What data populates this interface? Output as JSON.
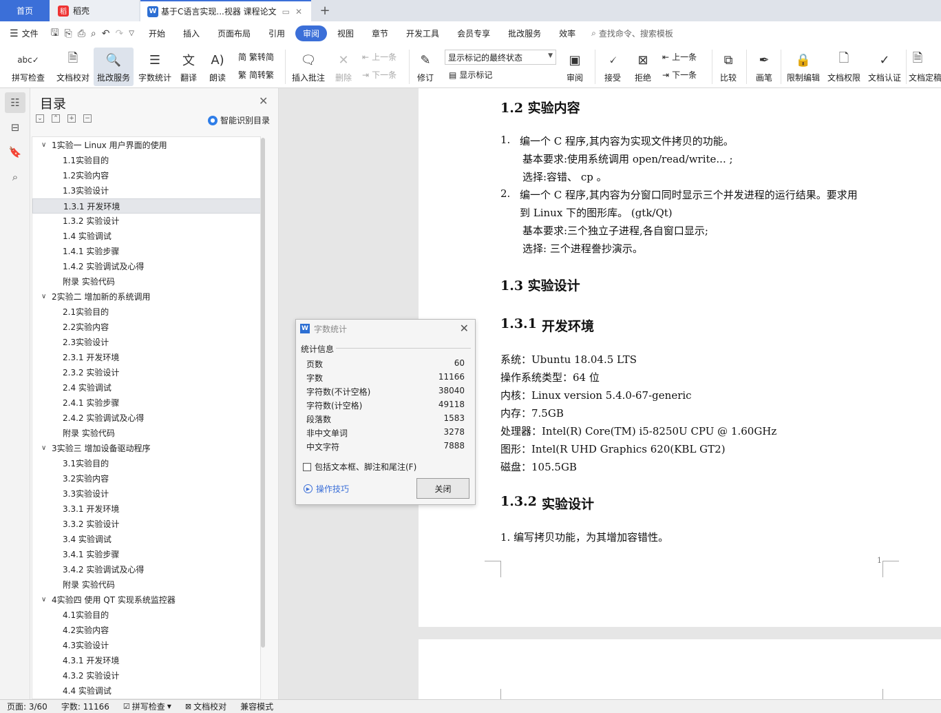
{
  "tabs": {
    "home": "首页",
    "daoke": "稻壳",
    "daoke_logo": "稻",
    "doc": "基于C语言实现...视器 课程论文",
    "doc_logo": "W",
    "plus": "+"
  },
  "menubar": {
    "file": "文件",
    "items": [
      "开始",
      "插入",
      "页面布局",
      "引用",
      "审阅",
      "视图",
      "章节",
      "开发工具",
      "会员专享",
      "批改服务",
      "效率"
    ],
    "active_item": "审阅",
    "search": "查找命令、搜索模板"
  },
  "ribbon": {
    "spell": "拼写检查",
    "proof": "文档校对",
    "correction": "批改服务",
    "wordcount": "字数统计",
    "translate": "翻译",
    "read": "朗读",
    "t2s": "繁转简",
    "s2t": "简转繁",
    "insert_comment": "插入批注",
    "delete": "删除",
    "prev_comment": "上一条",
    "next_comment": "下一条",
    "revise": "修订",
    "markup_state": "显示标记的最终状态",
    "show_markup": "显示标记",
    "review": "审阅",
    "accept": "接受",
    "reject": "拒绝",
    "prev_change": "上一条",
    "next_change": "下一条",
    "compare": "比较",
    "pen": "画笔",
    "restrict": "限制编辑",
    "permission": "文档权限",
    "certify": "文档认证",
    "finalize": "文档定稿"
  },
  "toc": {
    "title": "目录",
    "ai": "智能识别目录",
    "items": [
      {
        "label": "1实验一  Linux 用户界面的使用",
        "level": 1
      },
      {
        "label": "1.1实验目的",
        "level": 2
      },
      {
        "label": "1.2实验内容",
        "level": 2
      },
      {
        "label": "1.3实验设计",
        "level": 2
      },
      {
        "label": "1.3.1  开发环境",
        "level": 2,
        "selected": true
      },
      {
        "label": "1.3.2  实验设计",
        "level": 2
      },
      {
        "label": "1.4  实验调试",
        "level": 2
      },
      {
        "label": "1.4.1  实验步骤",
        "level": 2
      },
      {
        "label": "1.4.2  实验调试及心得",
        "level": 2
      },
      {
        "label": "附录  实验代码",
        "level": 2
      },
      {
        "label": "2实验二  增加新的系统调用",
        "level": 1
      },
      {
        "label": "2.1实验目的",
        "level": 2
      },
      {
        "label": "2.2实验内容",
        "level": 2
      },
      {
        "label": "2.3实验设计",
        "level": 2
      },
      {
        "label": "2.3.1  开发环境",
        "level": 2
      },
      {
        "label": "2.3.2  实验设计",
        "level": 2
      },
      {
        "label": "2.4  实验调试",
        "level": 2
      },
      {
        "label": "2.4.1  实验步骤",
        "level": 2
      },
      {
        "label": "2.4.2  实验调试及心得",
        "level": 2
      },
      {
        "label": "附录  实验代码",
        "level": 2
      },
      {
        "label": "3实验三  增加设备驱动程序",
        "level": 1
      },
      {
        "label": "3.1实验目的",
        "level": 2
      },
      {
        "label": "3.2实验内容",
        "level": 2
      },
      {
        "label": "3.3实验设计",
        "level": 2
      },
      {
        "label": "3.3.1  开发环境",
        "level": 2
      },
      {
        "label": "3.3.2  实验设计",
        "level": 2
      },
      {
        "label": "3.4  实验调试",
        "level": 2
      },
      {
        "label": "3.4.1  实验步骤",
        "level": 2
      },
      {
        "label": "3.4.2  实验调试及心得",
        "level": 2
      },
      {
        "label": "附录  实验代码",
        "level": 2
      },
      {
        "label": "4实验四  使用 QT 实现系统监控器",
        "level": 1
      },
      {
        "label": "4.1实验目的",
        "level": 2
      },
      {
        "label": "4.2实验内容",
        "level": 2
      },
      {
        "label": "4.3实验设计",
        "level": 2
      },
      {
        "label": "4.3.1  开发环境",
        "level": 2
      },
      {
        "label": "4.3.2  实验设计",
        "level": 2
      },
      {
        "label": "4.4  实验调试",
        "level": 2
      }
    ]
  },
  "document": {
    "h_content": "1.2 实验内容",
    "item1_num": "1.",
    "item1": "编一个 C 程序,其内容为实现文件拷贝的功能。",
    "item1_req": "基本要求:使用系统调用   open/read/write... ;",
    "item1_opt": "选择:容错、   cp   。",
    "item2_num": "2.",
    "item2": "编一个 C 程序,其内容为分窗口同时显示三个并发进程的运行结果。要求用",
    "item2_cont": "到 Linux 下的图形库。 (gtk/Qt)",
    "item2_req": "基本要求:三个独立子进程,各自窗口显示;",
    "item2_opt": "选择:  三个进程誊抄演示。",
    "h_design": "1.3 实验设计",
    "h_env_num": "1.3.1",
    "h_env": "开发环境",
    "env_lines": [
      "系统：Ubuntu 18.04.5 LTS",
      "操作系统类型：64 位",
      "内核：Linux version 5.4.0-67-generic",
      "内存：7.5GB",
      "处理器：Intel(R) Core(TM) i5-8250U CPU @ 1.60GHz",
      "图形：Intel(R UHD Graphics 620(KBL GT2)",
      "磁盘：105.5GB"
    ],
    "h_sub_num": "1.3.2",
    "h_sub": "实验设计",
    "sub_item": "1. 编写拷贝功能，为其增加容错性。",
    "page_number": "1"
  },
  "dialog": {
    "title": "字数统计",
    "logo": "W",
    "section": "统计信息",
    "stats": [
      {
        "label": "页数",
        "value": "60"
      },
      {
        "label": "字数",
        "value": "11166"
      },
      {
        "label": "字符数(不计空格)",
        "value": "38040"
      },
      {
        "label": "字符数(计空格)",
        "value": "49118"
      },
      {
        "label": "段落数",
        "value": "1583"
      },
      {
        "label": "非中文单词",
        "value": "3278"
      },
      {
        "label": "中文字符",
        "value": "7888"
      }
    ],
    "checkbox": "包括文本框、脚注和尾注(F)",
    "tips": "操作技巧",
    "close": "关闭"
  },
  "status": {
    "page": "页面: 3/60",
    "words": "字数: 11166",
    "spell": "拼写检查",
    "proof": "文档校对",
    "compat": "兼容模式"
  }
}
